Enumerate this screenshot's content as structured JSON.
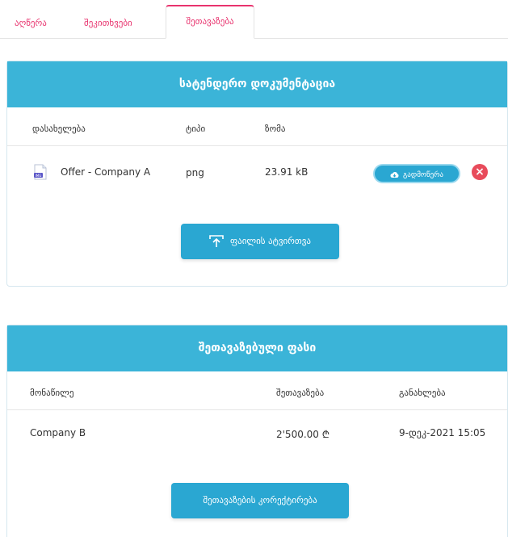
{
  "tabs": [
    {
      "label": "აღწერა"
    },
    {
      "label": "შეკითხვები"
    },
    {
      "label": "შეთავაზება"
    }
  ],
  "documents_card": {
    "title": "სატენდერო დოკუმენტაცია",
    "columns": {
      "name": "დასახელება",
      "type": "ტიპი",
      "size": "ზომა"
    },
    "files": [
      {
        "name": "Offer - Company A",
        "type": "png",
        "size": "23.91 kB",
        "download_label": "გადმოწერა"
      }
    ],
    "upload_label": "ფაილის ატვირთვა"
  },
  "offer_card": {
    "title": "შეთავაზებული ფასი",
    "columns": {
      "participant": "მონაწილე",
      "offer": "შეთავაზება",
      "updated": "განახლება"
    },
    "rows": [
      {
        "participant": "Company B",
        "offer": "2'500.00 ₾",
        "updated": "9-დეკ-2021 15:05"
      }
    ],
    "edit_label": "შეთავაზების კორექტირება"
  },
  "colors": {
    "accent": "#3bb4d8",
    "button": "#2aa7d2",
    "tab": "#e8336e",
    "danger": "#e84b5b"
  },
  "icons": {
    "file": "image-file-icon",
    "download": "cloud-download-icon",
    "remove": "close-circle-icon",
    "upload": "upload-icon"
  }
}
